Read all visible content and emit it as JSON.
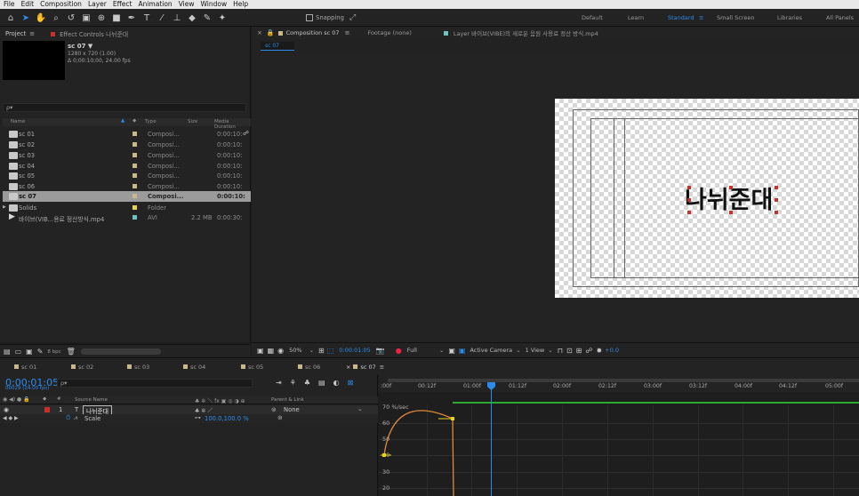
{
  "menu": [
    "File",
    "Edit",
    "Composition",
    "Layer",
    "Effect",
    "Animation",
    "View",
    "Window",
    "Help"
  ],
  "toolbar": {
    "snapping_label": "Snapping",
    "workspaces": [
      "Default",
      "Learn",
      "Standard",
      "Small Screen",
      "Libraries",
      "All Panels"
    ],
    "active_workspace": "Standard"
  },
  "project": {
    "tab_label": "Project",
    "effect_controls_label": "Effect Controls 나뉘준대",
    "selected_name": "sc 07 ▼",
    "selected_res": "1280 x 720 (1.00)",
    "selected_dur": "Δ 0;00:10;00, 24.00 fps",
    "search_placeholder": "ρ▾",
    "columns": {
      "name": "Name",
      "type": "Type",
      "size": "Size",
      "duration": "Media Duration"
    },
    "items": [
      {
        "name": "sc 01",
        "type": "Composi...",
        "size": "",
        "duration": "0:00:10:",
        "selected": false
      },
      {
        "name": "sc 02",
        "type": "Composi...",
        "size": "",
        "duration": "0:00:10:",
        "selected": false
      },
      {
        "name": "sc 03",
        "type": "Composi...",
        "size": "",
        "duration": "0:00:10:",
        "selected": false
      },
      {
        "name": "sc 04",
        "type": "Composi...",
        "size": "",
        "duration": "0:00:10:",
        "selected": false
      },
      {
        "name": "sc 05",
        "type": "Composi...",
        "size": "",
        "duration": "0:00:10:",
        "selected": false
      },
      {
        "name": "sc 06",
        "type": "Composi...",
        "size": "",
        "duration": "0:00:10:",
        "selected": false
      },
      {
        "name": "sc 07",
        "type": "Composi...",
        "size": "",
        "duration": "0:00:10:",
        "selected": true
      },
      {
        "name": "Solids",
        "type": "Folder",
        "size": "",
        "duration": "",
        "selected": false
      },
      {
        "name": "바이브(VIB...용료 정산방식.mp4",
        "type": "AVI",
        "size": "2.2 MB",
        "duration": "0:00:30:",
        "selected": false
      }
    ],
    "footer_bpc": "8 bpc"
  },
  "viewer": {
    "tabs": [
      "Composition sc 07",
      "Footage (none)",
      "Layer 바이브(VIBE)의 새로운 음원 사용료 정산 방식.mp4"
    ],
    "subtab": "sc 07",
    "comp_text": "나뉘준대",
    "zoom": "50%",
    "timecode": "0:00:01:05",
    "resolution": "Full",
    "camera": "Active Camera",
    "views": "1 View",
    "exposure": "+0.0"
  },
  "timeline": {
    "tabs": [
      "sc 01",
      "sc 02",
      "sc 03",
      "sc 04",
      "sc 05",
      "sc 06",
      "sc 07"
    ],
    "active_tab": "sc 07",
    "current_time": "0:00:01:05",
    "current_frames": "00029 (24.00 fps)",
    "search_placeholder": "ρ▾",
    "columns": {
      "source_name": "Source Name",
      "parent": "Parent & Link"
    },
    "layer": {
      "number": "1",
      "name": "나뉘준대",
      "parent": "None"
    },
    "property": {
      "name": "Scale",
      "value": "100.0,100.0 %"
    },
    "ruler_ticks": [
      ":00f",
      "00:12f",
      "01:00f",
      "01:12f",
      "02:00f",
      "02:12f",
      "03:00f",
      "03:12f",
      "04:00f",
      "04:12f",
      "05:00f"
    ],
    "graph_unit": "70 %/sec",
    "graph_labels": [
      "60",
      "50",
      "40",
      "30",
      "20"
    ]
  },
  "colors": {
    "accent": "#2d8ceb",
    "label_red": "#c8302a",
    "label_sand": "#c9b888",
    "keyframe": "#e8d31a"
  }
}
